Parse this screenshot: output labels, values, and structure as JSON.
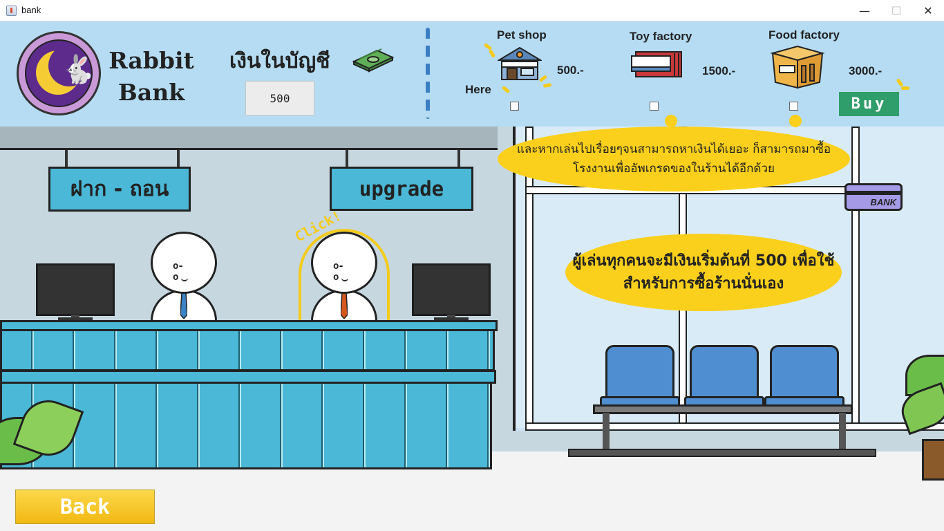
{
  "window": {
    "title": "bank",
    "min_icon": "—",
    "max_icon": "☐",
    "close_icon": "✕"
  },
  "header": {
    "bank_name": "Rabbit Bank",
    "balance_label": "เงินในบัญชี",
    "balance_value": "500",
    "here_label": "Here",
    "buy_label": "Buy",
    "shops": [
      {
        "name": "Pet shop",
        "price": "500.-",
        "icon": "pet-shop-icon",
        "checked": false
      },
      {
        "name": "Toy factory",
        "price": "1500.-",
        "icon": "toy-factory-icon",
        "checked": false
      },
      {
        "name": "Food factory",
        "price": "3000.-",
        "icon": "food-factory-icon",
        "checked": false
      }
    ]
  },
  "scene": {
    "sign_deposit": "ฝาก - ถอน",
    "sign_upgrade": "upgrade",
    "click_text": "Click!",
    "bank_card_label": "BANK",
    "bubble_upgrade": "และหากเล่นไปเรื่อยๆจนสามารถหาเงินได้เยอะ ก็สามารถมาซื้อโรงงานเพื่ออัพเกรดของในร้านได้อีกด้วย",
    "bubble_start": "ผู้เล่นทุกคนจะมีเงินเริ่มต้นที่ 500 เพื่อใช้สำหรับการซื้อร้านนั่นเอง"
  },
  "footer": {
    "back_label": "Back"
  },
  "colors": {
    "header_bg": "#b5dcf3",
    "buy_button": "#2f9e6a",
    "back_button": "#f4c628",
    "bubble": "#fad01c",
    "counter": "#4ab8d6"
  }
}
